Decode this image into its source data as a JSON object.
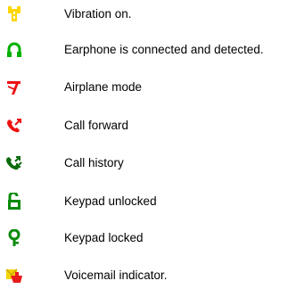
{
  "items": [
    {
      "icon": "vibration-icon",
      "label": "Vibration on.",
      "color": "#ffd700"
    },
    {
      "icon": "earphone-icon",
      "label": "Earphone is connected and detected.",
      "color": "#00b000"
    },
    {
      "icon": "airplane-mode-icon",
      "label": "Airplane mode",
      "color": "#ee1111"
    },
    {
      "icon": "call-forward-icon",
      "label": "Call forward",
      "color": "#ee1111"
    },
    {
      "icon": "call-history-icon",
      "label": "Call history",
      "color": "#0a6b0a"
    },
    {
      "icon": "keypad-unlocked-icon",
      "label": "Keypad unlocked",
      "color": "#0a8a0a"
    },
    {
      "icon": "keypad-locked-icon",
      "label": "Keypad locked",
      "color": "#0a8a0a"
    },
    {
      "icon": "voicemail-indicator-icon",
      "label": "Voicemail indicator.",
      "color": "#e81c1c"
    }
  ]
}
